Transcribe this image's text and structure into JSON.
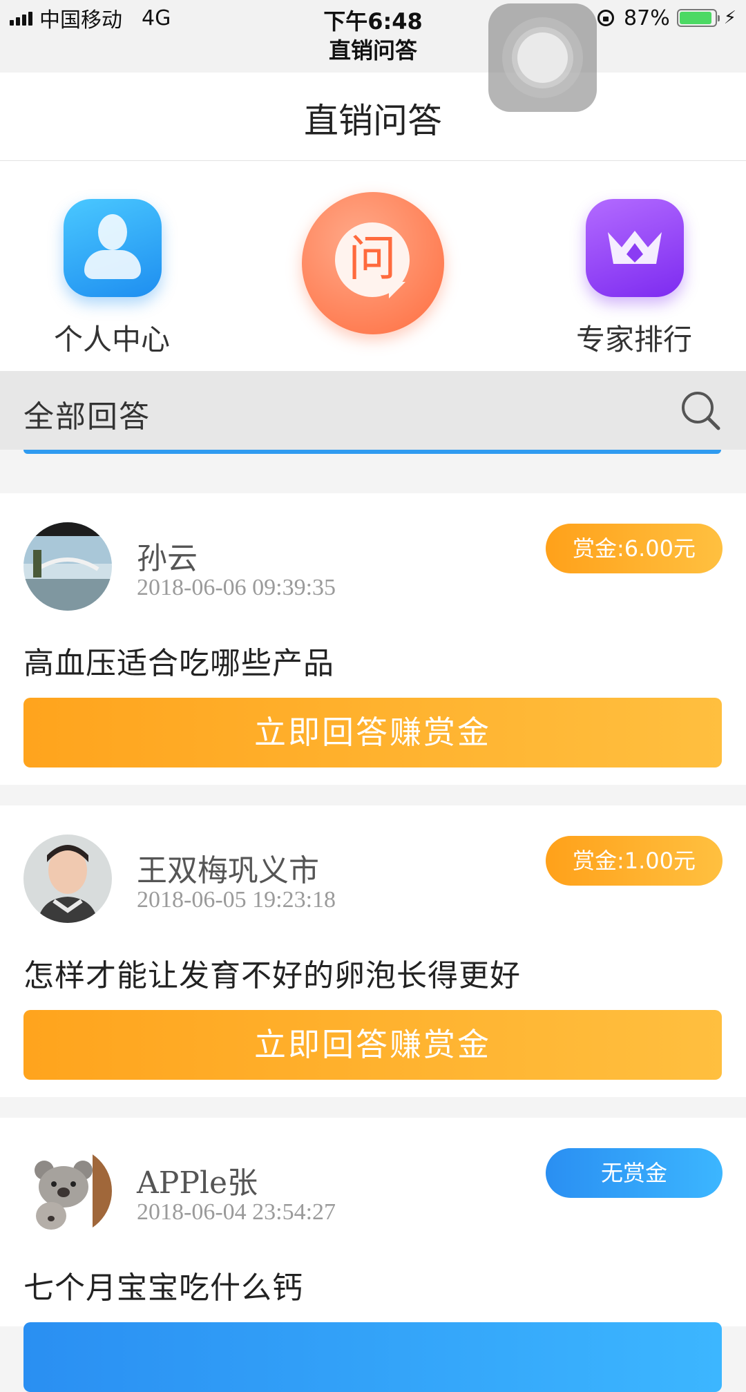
{
  "status_bar": {
    "carrier": "中国移动",
    "network": "4G",
    "time": "下午6:48",
    "subtitle": "直销问答",
    "battery": "87%",
    "battery_level": 0.87
  },
  "nav": {
    "title": "直销问答"
  },
  "menu": {
    "personal_center": "个人中心",
    "ask_glyph": "问",
    "expert_ranking": "专家排行"
  },
  "filter": {
    "label": "全部回答"
  },
  "questions": [
    {
      "user": "孙云",
      "time": "2018-06-06 09:39:35",
      "bounty": "赏金:6.00元",
      "question": "高血压适合吃哪些产品",
      "button": "立即回答赚赏金"
    },
    {
      "user": "王双梅巩义市",
      "time": "2018-06-05 19:23:18",
      "bounty": "赏金:1.00元",
      "question": "怎样才能让发育不好的卵泡长得更好",
      "button": "立即回答赚赏金"
    },
    {
      "user": "APPle张",
      "time": "2018-06-04 23:54:27",
      "bounty": "无赏金",
      "question": "七个月宝宝吃什么钙",
      "button": ""
    }
  ],
  "colors": {
    "gold": "#ffa11a",
    "blue": "#2a8ff2",
    "orange": "#ff6d3f",
    "purple": "#7d2bf0"
  }
}
